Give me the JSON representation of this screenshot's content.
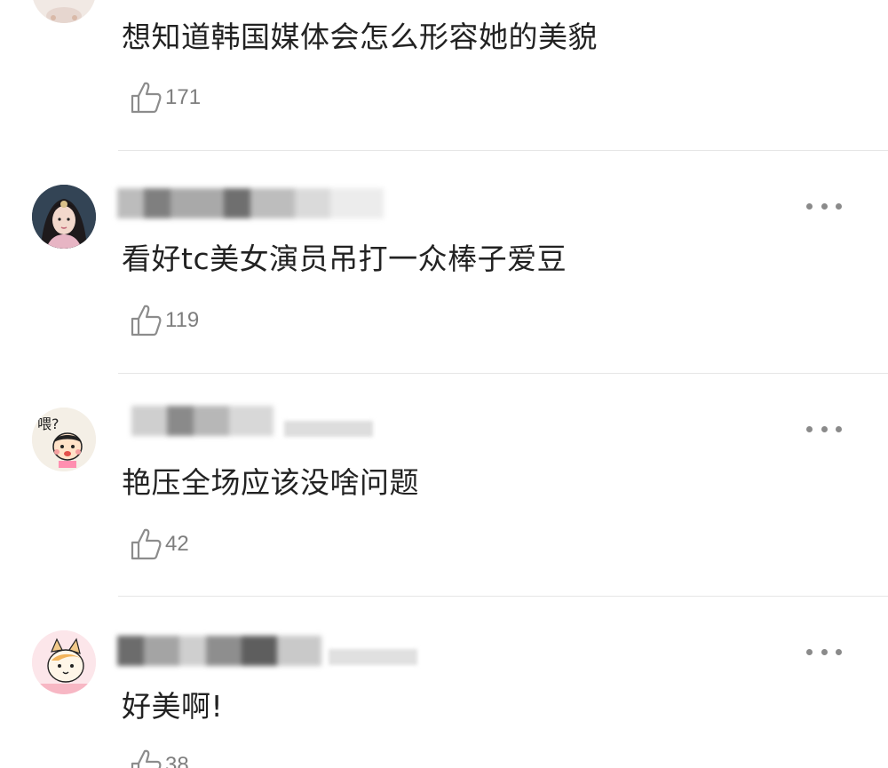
{
  "comments": [
    {
      "text": "想知道韩国媒体会怎么形容她的美貌",
      "likes": "171",
      "avatar_icon": "avatar-partial-icon"
    },
    {
      "text": "看好tc美女演员吊打一众棒子爱豆",
      "likes": "119",
      "avatar_icon": "avatar-costume-girl-icon"
    },
    {
      "text": "艳压全场应该没啥问题",
      "likes": "42",
      "avatar_icon": "avatar-cartoon-wei-icon",
      "avatar_caption": "喂?"
    },
    {
      "text": "好美啊!",
      "likes": "38",
      "avatar_icon": "avatar-cartoon-cat-icon"
    }
  ],
  "icons": {
    "like": "thumbs-up-icon",
    "more": "more-dots-icon"
  },
  "colors": {
    "text": "#222222",
    "meta": "#7e7e7e",
    "divider": "#e6e6e6"
  }
}
